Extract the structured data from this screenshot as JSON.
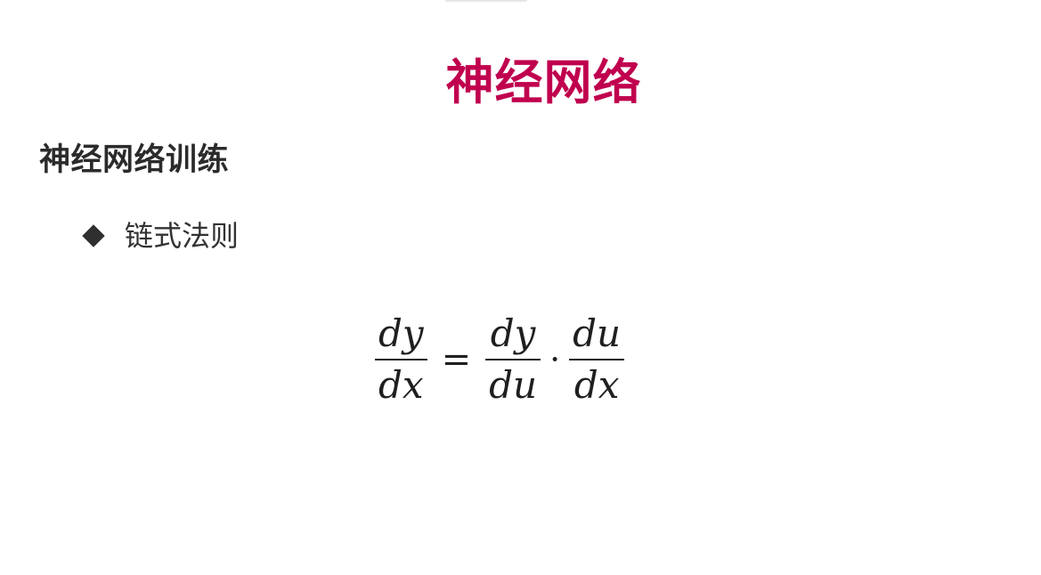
{
  "slide": {
    "title": "神经网络",
    "section_heading": "神经网络训练",
    "bullets": [
      {
        "icon": "diamond-bullet-icon",
        "text": "链式法则"
      }
    ]
  },
  "formula": {
    "lhs": {
      "numerator": "dy",
      "denominator": "dx"
    },
    "equals": "=",
    "rhs_first": {
      "numerator": "dy",
      "denominator": "du"
    },
    "times": "·",
    "rhs_second": {
      "numerator": "du",
      "denominator": "dx"
    }
  },
  "colors": {
    "title": "#c0004e",
    "text": "#333333",
    "background": "#ffffff"
  }
}
